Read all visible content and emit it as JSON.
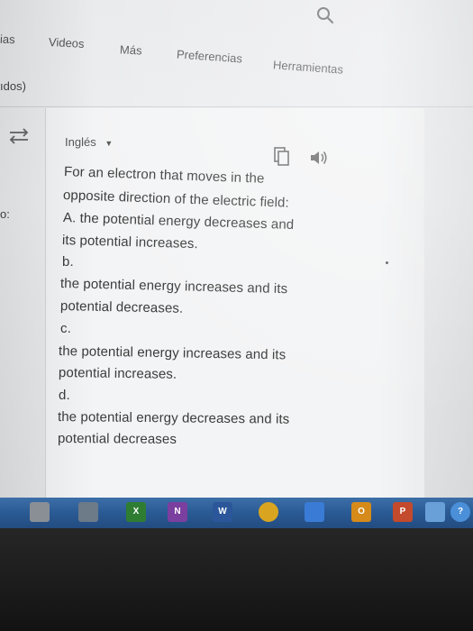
{
  "nav": {
    "fragment_left": "ias",
    "tabs": [
      "Videos",
      "Más",
      "Preferencias",
      "Herramientas"
    ]
  },
  "left_fragments": {
    "line1": "ıdos)",
    "line2": "o:"
  },
  "translator": {
    "language": "Inglés",
    "lines": [
      "For an electron that moves in the",
      "opposite direction of the electric field:",
      "A. the potential energy decreases and",
      "its potential increases.",
      "b.",
      "the potential energy increases and its",
      "potential decreases.",
      "c.",
      "the potential energy increases and its",
      "potential increases.",
      "d.",
      "the potential energy decreases and its",
      "potential decreases"
    ]
  },
  "taskbar": {
    "icons": [
      {
        "name": "folder-icon",
        "label": "",
        "color": "#8a8f96"
      },
      {
        "name": "calculator-icon",
        "label": "",
        "color": "#6d7a88"
      },
      {
        "name": "excel-icon",
        "label": "X",
        "color": "#2e7d32"
      },
      {
        "name": "onenote-icon",
        "label": "N",
        "color": "#7b3fa0"
      },
      {
        "name": "word-icon",
        "label": "W",
        "color": "#2b579a"
      },
      {
        "name": "chrome-icon",
        "label": "",
        "color": "#d9a520"
      },
      {
        "name": "media-icon",
        "label": "",
        "color": "#3a7bd5"
      },
      {
        "name": "outlook-icon",
        "label": "O",
        "color": "#d58a1a"
      },
      {
        "name": "powerpoint-icon",
        "label": "P",
        "color": "#c34a2c"
      },
      {
        "name": "paint-icon",
        "label": "",
        "color": "#6aa0d8"
      },
      {
        "name": "help-icon",
        "label": "?",
        "color": "#4a8fd8"
      }
    ]
  }
}
